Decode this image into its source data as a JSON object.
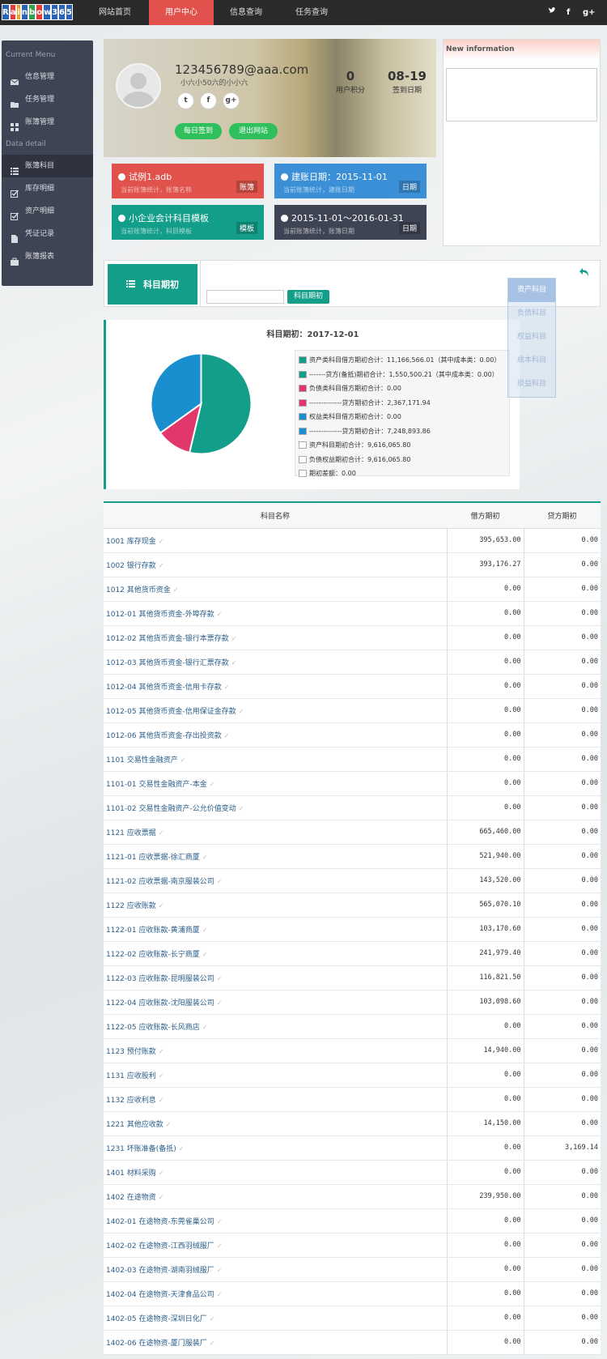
{
  "logo": {
    "letters": [
      "R",
      "a",
      "i",
      "n",
      "b",
      "o",
      "w",
      "3",
      "6",
      "5"
    ],
    "colors": [
      "#2b63b8",
      "#e83a3a",
      "#f0a020",
      "#2b63b8",
      "#2fa050",
      "#e83a3a",
      "#2b63b8",
      "#2b63b8",
      "#2b63b8",
      "#2b63b8"
    ]
  },
  "nav": {
    "items": [
      "网站首页",
      "用户中心",
      "信息查询",
      "任务查询"
    ],
    "active_index": 1,
    "social": [
      "twitter-icon",
      "facebook-icon",
      "google-plus-icon"
    ]
  },
  "sidebar": {
    "section1": "Current Menu",
    "menu": [
      "信息管理",
      "任务管理",
      "账簿管理"
    ],
    "section2": "Data detail",
    "detail": [
      "账簿科目",
      "库存明细",
      "资产明细",
      "凭证记录",
      "账簿报表"
    ],
    "active_detail_index": 0
  },
  "profile": {
    "email": "123456789@aaa.com",
    "subname": "小六小50六的小小六",
    "points_value": "0",
    "points_label": "用户积分",
    "sign_value": "08-19",
    "sign_label": "签到日期",
    "btn_sign": "每日签到",
    "btn_logout": "退出网站"
  },
  "tiles": [
    {
      "title": "试例1.adb",
      "sub": "当前账簿统计，账簿名称",
      "badge": "账簿",
      "color": "#e0524b"
    },
    {
      "title": "建账日期：2015-11-01",
      "sub": "当前账簿统计，建账日期",
      "badge": "日期",
      "color": "#3a8fd6"
    },
    {
      "title": "小企业会计科目模板",
      "sub": "当前账簿统计，科目模板",
      "badge": "模板",
      "color": "#139e8a"
    },
    {
      "title": "2015-11-01～2016-01-31",
      "sub": "当前账簿统计，账簿日期",
      "badge": "日期",
      "color": "#3f4454"
    }
  ],
  "news": {
    "title": "New information"
  },
  "toolbar": {
    "label": "科目期初",
    "button": "科目期初",
    "input_value": ""
  },
  "dropdown": [
    "资产科目",
    "负债科目",
    "权益科目",
    "成本科目",
    "损益科目"
  ],
  "chart_data": {
    "type": "pie",
    "title": "科目期初：2017-12-01",
    "slices": [
      {
        "label": "资产类科目借方期初合计",
        "value": 11166566.01,
        "color": "#139e8a"
      },
      {
        "label": "负债类科目贷方期初合计",
        "value": 2367171.94,
        "color": "#e2376a"
      },
      {
        "label": "权益类科目贷方期初合计",
        "value": 7248893.86,
        "color": "#1a8fcf"
      }
    ],
    "legend": [
      {
        "text": "资产类科目借方期初合计：11,166,566.01（其中成本类：0.00）",
        "color": "#139e8a"
      },
      {
        "text": "-------贷方(备抵)期初合计：1,550,500.21（其中成本类：0.00）",
        "color": "#139e8a"
      },
      {
        "text": "负债类科目借方期初合计：0.00",
        "color": "#e2376a"
      },
      {
        "text": "--------------贷方期初合计：2,367,171.94",
        "color": "#e2376a"
      },
      {
        "text": "权益类科目借方期初合计：0.00",
        "color": "#1a8fcf"
      },
      {
        "text": "--------------贷方期初合计：7,248,893.86",
        "color": "#1a8fcf"
      },
      {
        "text": "资产科目期初合计：9,616,065.80",
        "color": "#ffffff"
      },
      {
        "text": "负债权益期初合计：9,616,065.80",
        "color": "#ffffff"
      },
      {
        "text": "期初差额：0.00",
        "color": "#ffffff"
      }
    ]
  },
  "table": {
    "headers": [
      "科目名称",
      "借方期初",
      "贷方期初"
    ],
    "rows": [
      [
        "1001 库存现金",
        "395,653.00",
        "0.00"
      ],
      [
        "1002 银行存款",
        "393,176.27",
        "0.00"
      ],
      [
        "1012 其他货币资金",
        "0.00",
        "0.00"
      ],
      [
        "1012-01 其他货币资金-外埠存款",
        "0.00",
        "0.00"
      ],
      [
        "1012-02 其他货币资金-银行本票存款",
        "0.00",
        "0.00"
      ],
      [
        "1012-03 其他货币资金-银行汇票存款",
        "0.00",
        "0.00"
      ],
      [
        "1012-04 其他货币资金-信用卡存款",
        "0.00",
        "0.00"
      ],
      [
        "1012-05 其他货币资金-信用保证金存款",
        "0.00",
        "0.00"
      ],
      [
        "1012-06 其他货币资金-存出投资款",
        "0.00",
        "0.00"
      ],
      [
        "1101 交易性金融资产",
        "0.00",
        "0.00"
      ],
      [
        "1101-01 交易性金融资产-本金",
        "0.00",
        "0.00"
      ],
      [
        "1101-02 交易性金融资产-公允价值变动",
        "0.00",
        "0.00"
      ],
      [
        "1121 应收票据",
        "665,460.00",
        "0.00"
      ],
      [
        "1121-01 应收票据-徐汇商厦",
        "521,940.00",
        "0.00"
      ],
      [
        "1121-02 应收票据-南京服装公司",
        "143,520.00",
        "0.00"
      ],
      [
        "1122 应收账款",
        "565,070.10",
        "0.00"
      ],
      [
        "1122-01 应收账款-黄浦商厦",
        "103,170.60",
        "0.00"
      ],
      [
        "1122-02 应收账款-长宁商厦",
        "241,979.40",
        "0.00"
      ],
      [
        "1122-03 应收账款-昆明服装公司",
        "116,821.50",
        "0.00"
      ],
      [
        "1122-04 应收账款-沈阳服装公司",
        "103,098.60",
        "0.00"
      ],
      [
        "1122-05 应收账款-长风商店",
        "0.00",
        "0.00"
      ],
      [
        "1123 预付账款",
        "14,940.00",
        "0.00"
      ],
      [
        "1131 应收股利",
        "0.00",
        "0.00"
      ],
      [
        "1132 应收利息",
        "0.00",
        "0.00"
      ],
      [
        "1221 其他应收款",
        "14,150.00",
        "0.00"
      ],
      [
        "1231 坏账准备(备抵)",
        "0.00",
        "3,169.14"
      ],
      [
        "1401 材料采购",
        "0.00",
        "0.00"
      ],
      [
        "1402 在途物资",
        "239,950.00",
        "0.00"
      ],
      [
        "1402-01 在途物资-东莞雀巢公司",
        "0.00",
        "0.00"
      ],
      [
        "1402-02 在途物资-江西羽绒服厂",
        "0.00",
        "0.00"
      ],
      [
        "1402-03 在途物资-湖南羽绒服厂",
        "0.00",
        "0.00"
      ],
      [
        "1402-04 在途物资-天津食品公司",
        "0.00",
        "0.00"
      ],
      [
        "1402-05 在途物资-深圳日化厂",
        "0.00",
        "0.00"
      ],
      [
        "1402-06 在途物资-厦门服装厂",
        "0.00",
        "0.00"
      ]
    ]
  }
}
